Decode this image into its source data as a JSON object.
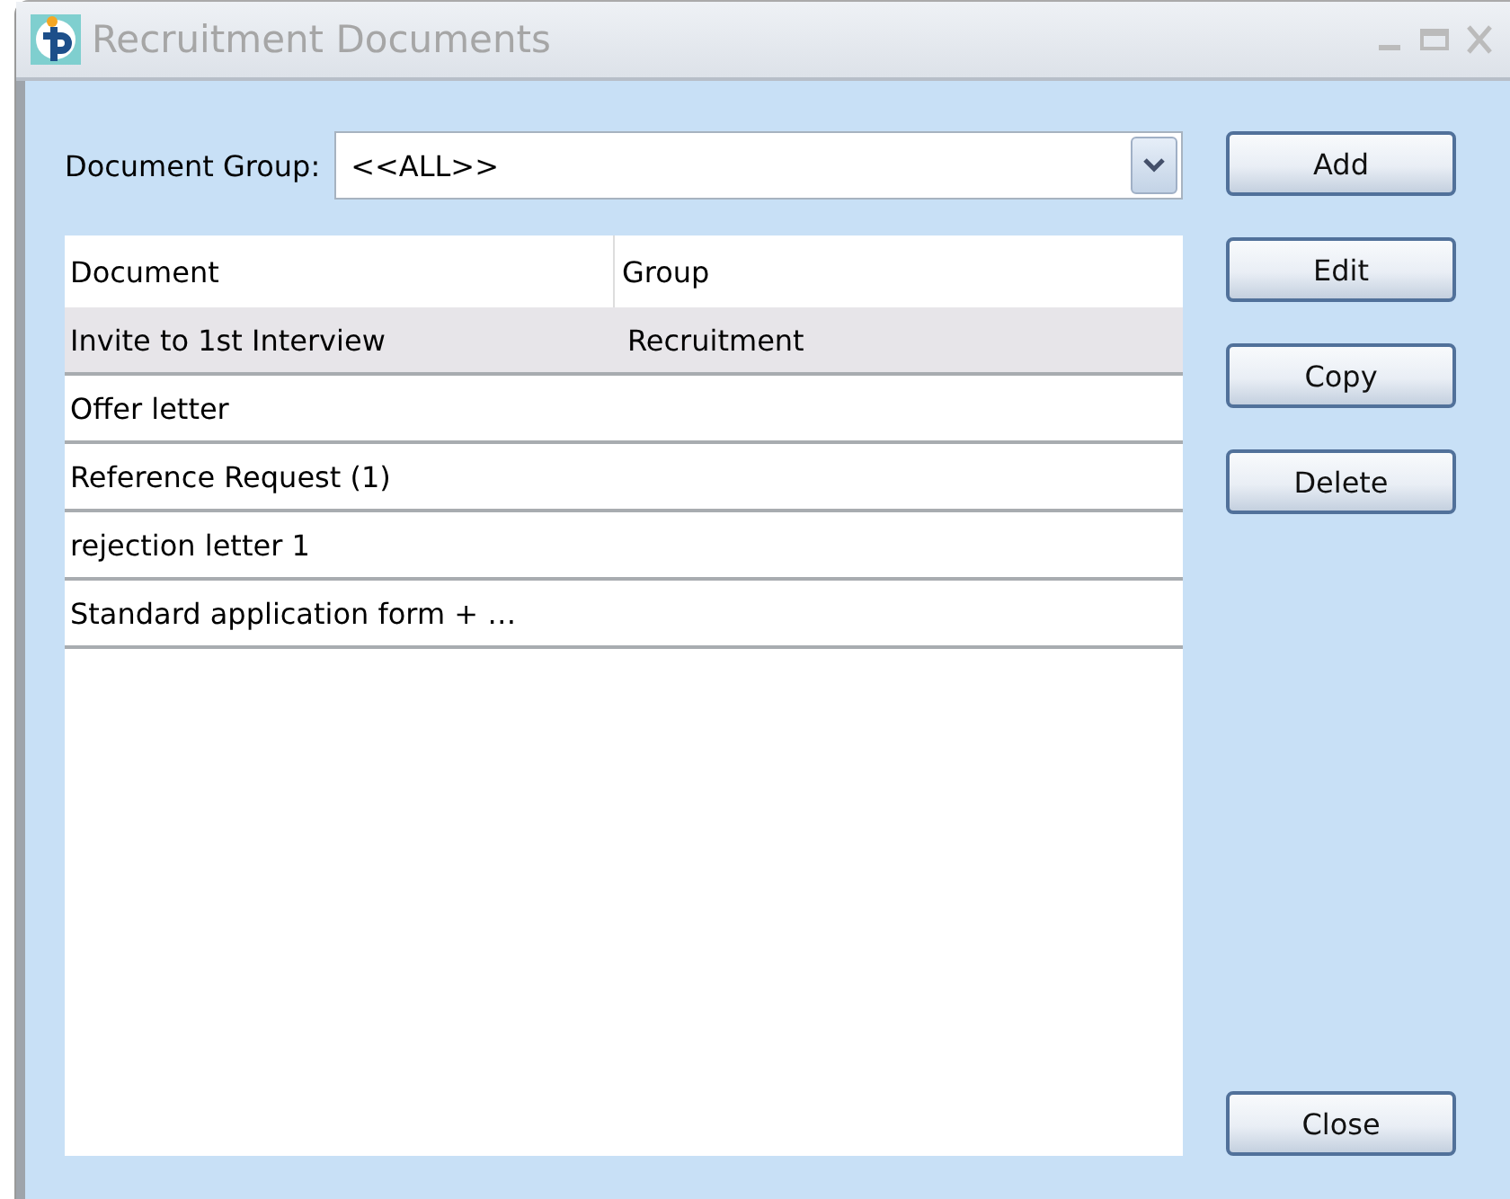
{
  "window": {
    "title": "Recruitment Documents"
  },
  "filter": {
    "label": "Document Group:",
    "value": "<<ALL>>"
  },
  "table": {
    "columns": [
      "Document",
      "Group"
    ],
    "rows": [
      {
        "cells": [
          "Invite to 1st Interview",
          "Recruitment"
        ],
        "selected": true
      },
      {
        "cells": [
          "Offer letter",
          ""
        ],
        "selected": false
      },
      {
        "cells": [
          "Reference Request (1)",
          ""
        ],
        "selected": false
      },
      {
        "cells": [
          "rejection letter 1",
          ""
        ],
        "selected": false
      },
      {
        "cells": [
          "Standard application form + …",
          ""
        ],
        "selected": false
      }
    ]
  },
  "buttons": [
    "Add",
    "Edit",
    "Copy",
    "Delete"
  ],
  "close_button": "Close"
}
